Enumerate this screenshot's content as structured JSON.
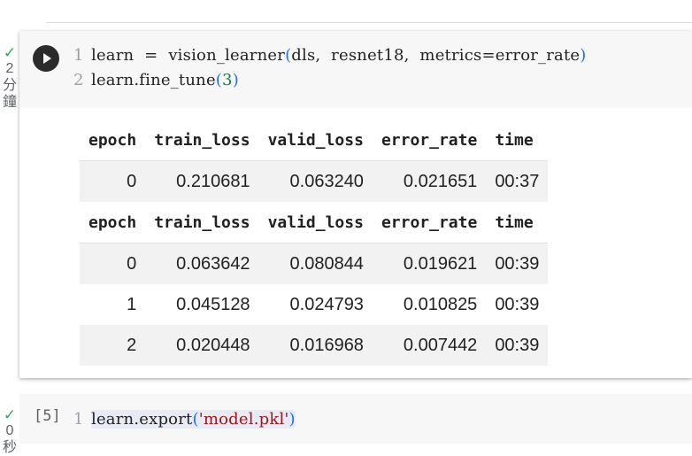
{
  "cell1": {
    "status_icon": "check-icon",
    "duration": [
      "2",
      "分",
      "鐘"
    ],
    "code_lines": [
      {
        "num": "1",
        "text": "learn  =  vision_learner(dls,  resnet18,  metrics=error_rate)"
      },
      {
        "num": "2",
        "text": "learn.fine_tune(3)"
      }
    ],
    "tables": [
      {
        "headers": [
          "epoch",
          "train_loss",
          "valid_loss",
          "error_rate",
          "time"
        ],
        "rows": [
          [
            "0",
            "0.210681",
            "0.063240",
            "0.021651",
            "00:37"
          ]
        ]
      },
      {
        "headers": [
          "epoch",
          "train_loss",
          "valid_loss",
          "error_rate",
          "time"
        ],
        "rows": [
          [
            "0",
            "0.063642",
            "0.080844",
            "0.019621",
            "00:39"
          ],
          [
            "1",
            "0.045128",
            "0.024793",
            "0.010825",
            "00:39"
          ],
          [
            "2",
            "0.020448",
            "0.016968",
            "0.007442",
            "00:39"
          ]
        ]
      }
    ]
  },
  "cell2": {
    "status_icon": "check-icon",
    "duration": [
      "0",
      "秒"
    ],
    "exec_count": "[5]",
    "code_lines": [
      {
        "num": "1",
        "text": "learn.export('model.pkl')"
      }
    ]
  },
  "colors": {
    "success": "#34a853",
    "code_bg": "#f7f7f7",
    "row_shade": "#f2f2f2"
  }
}
